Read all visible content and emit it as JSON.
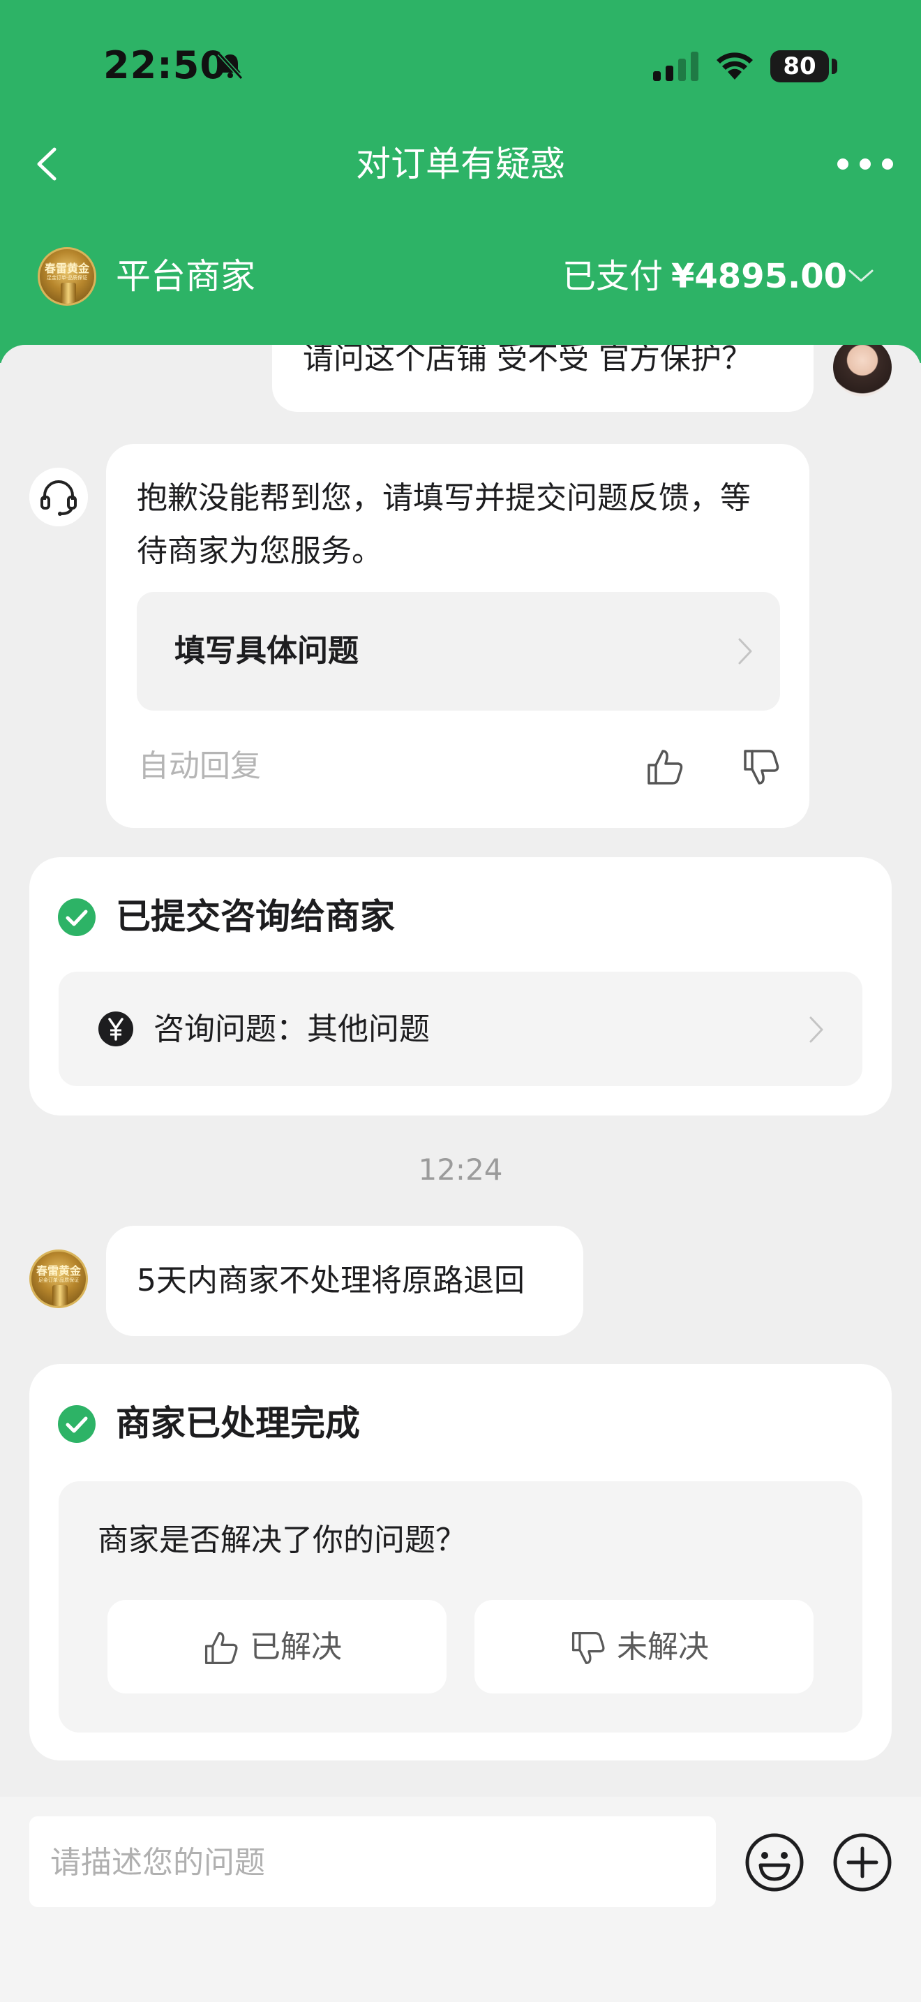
{
  "status_bar": {
    "time": "22:50",
    "battery": "80"
  },
  "nav": {
    "title": "对订单有疑惑"
  },
  "order": {
    "merchant_name": "平台商家",
    "merchant_logo_text": "春雷黄金",
    "merchant_logo_sub": "足金订单·品质保证",
    "paid_label": "已支付",
    "paid_amount": "¥4895.00"
  },
  "messages": {
    "user_question": "请问这个店铺 受不受 官方保护？",
    "bot_reply": "抱歉没能帮到您，请填写并提交问题反馈，等待商家为您服务。",
    "fill_problem_label": "填写具体问题",
    "auto_reply_label": "自动回复",
    "submitted_title": "已提交咨询给商家",
    "inquiry_label": "咨询问题：其他问题",
    "timestamp": "12:24",
    "merchant_message": "5天内商家不处理将原路退回",
    "processed_title": "商家已处理完成",
    "resolve_question": "商家是否解决了你的问题？",
    "resolved_label": "已解决",
    "unresolved_label": "未解决"
  },
  "input": {
    "placeholder": "请描述您的问题"
  },
  "colors": {
    "brand_green": "#2db366",
    "check_green": "#2db366"
  }
}
